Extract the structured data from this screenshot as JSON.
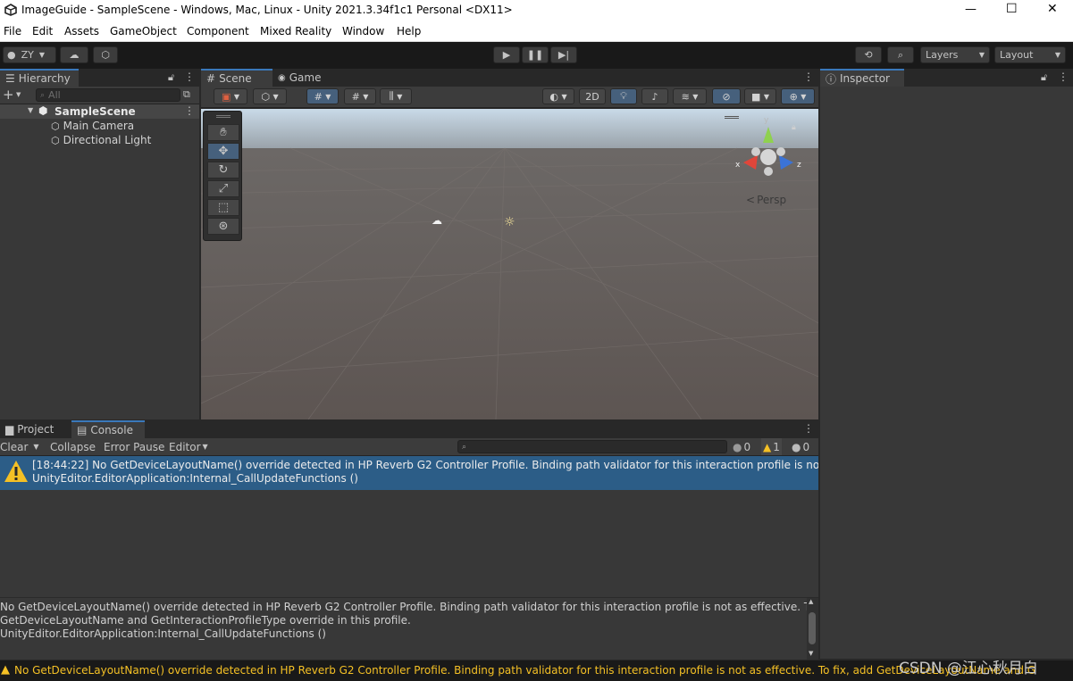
{
  "window": {
    "title": "ImageGuide - SampleScene - Windows, Mac, Linux - Unity 2021.3.34f1c1 Personal <DX11>",
    "controls": [
      "—",
      "☐",
      "✕"
    ]
  },
  "menubar": {
    "items": [
      "File",
      "Edit",
      "Assets",
      "GameObject",
      "Component",
      "Mixed Reality",
      "Window",
      "Help"
    ]
  },
  "toolbar": {
    "account": "ZY",
    "layers_label": "Layers",
    "layout_label": "Layout"
  },
  "hierarchy": {
    "tab": "Hierarchy",
    "search_placeholder": "All",
    "scene": "SampleScene",
    "items": [
      "Main Camera",
      "Directional Light"
    ]
  },
  "scene_view": {
    "tabs": [
      "Scene",
      "Game"
    ],
    "toggle_2d": "2D",
    "gizmo_label": "Persp",
    "axis_x": "x",
    "axis_y": "y",
    "axis_z": "z"
  },
  "inspector": {
    "tab": "Inspector"
  },
  "bottom_panel": {
    "tabs": [
      "Project",
      "Console"
    ],
    "buttons": {
      "clear": "Clear",
      "collapse": "Collapse",
      "error_pause": "Error Pause",
      "editor": "Editor"
    },
    "counts": {
      "info": "0",
      "warn": "1",
      "error": "0"
    },
    "log_entry": {
      "line1": "[18:44:22] No GetDeviceLayoutName() override detected in HP Reverb G2 Controller Profile. Binding path validator for this interaction profile is not as effective.",
      "line2": "UnityEditor.EditorApplication:Internal_CallUpdateFunctions ()"
    },
    "details": {
      "line1": "No GetDeviceLayoutName() override detected in HP Reverb G2 Controller Profile. Binding path validator for this interaction profile is not as effective. To fix, add",
      "line2": "GetDeviceLayoutName and GetInteractionProfileType override in this profile.",
      "line3": "UnityEditor.EditorApplication:Internal_CallUpdateFunctions ()"
    }
  },
  "statusbar": {
    "message": "No GetDeviceLayoutName() override detected in HP Reverb G2 Controller Profile. Binding path validator for this interaction profile is not as effective. To fix, add GetDeviceLayoutName and G",
    "watermark": "CSDN @江心秋月白"
  },
  "colors": {
    "selection": "#2c5d87",
    "accent": "#3a79bb",
    "warning": "#f4c025"
  }
}
